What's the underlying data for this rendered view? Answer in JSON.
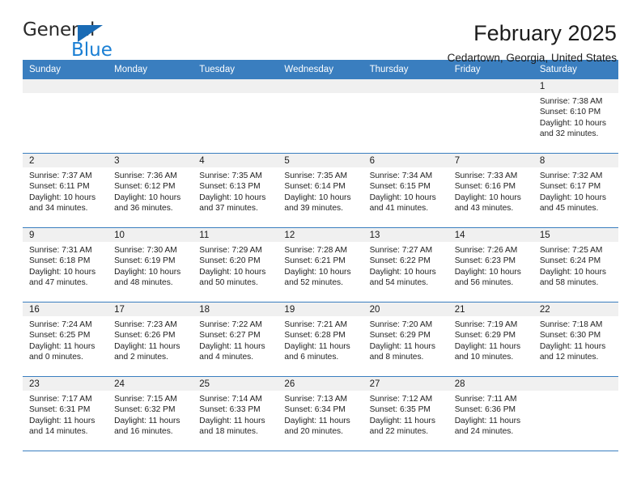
{
  "brand": {
    "word_one": "General",
    "word_two": "Blue",
    "triangle_color": "#1a6bb5",
    "blue_color": "#1a7fd4"
  },
  "header": {
    "title": "February 2025",
    "subtitle": "Cedartown, Georgia, United States"
  },
  "theme": {
    "header_blue": "#3a7ebf",
    "daynum_gray": "#f0f0f0"
  },
  "weekdays": [
    "Sunday",
    "Monday",
    "Tuesday",
    "Wednesday",
    "Thursday",
    "Friday",
    "Saturday"
  ],
  "weeks": [
    [
      {
        "day": "",
        "sunrise": "",
        "sunset": "",
        "daylight": "",
        "blank": true
      },
      {
        "day": "",
        "sunrise": "",
        "sunset": "",
        "daylight": "",
        "blank": true
      },
      {
        "day": "",
        "sunrise": "",
        "sunset": "",
        "daylight": "",
        "blank": true
      },
      {
        "day": "",
        "sunrise": "",
        "sunset": "",
        "daylight": "",
        "blank": true
      },
      {
        "day": "",
        "sunrise": "",
        "sunset": "",
        "daylight": "",
        "blank": true
      },
      {
        "day": "",
        "sunrise": "",
        "sunset": "",
        "daylight": "",
        "blank": true
      },
      {
        "day": "1",
        "sunrise": "Sunrise: 7:38 AM",
        "sunset": "Sunset: 6:10 PM",
        "daylight": "Daylight: 10 hours and 32 minutes."
      }
    ],
    [
      {
        "day": "2",
        "sunrise": "Sunrise: 7:37 AM",
        "sunset": "Sunset: 6:11 PM",
        "daylight": "Daylight: 10 hours and 34 minutes."
      },
      {
        "day": "3",
        "sunrise": "Sunrise: 7:36 AM",
        "sunset": "Sunset: 6:12 PM",
        "daylight": "Daylight: 10 hours and 36 minutes."
      },
      {
        "day": "4",
        "sunrise": "Sunrise: 7:35 AM",
        "sunset": "Sunset: 6:13 PM",
        "daylight": "Daylight: 10 hours and 37 minutes."
      },
      {
        "day": "5",
        "sunrise": "Sunrise: 7:35 AM",
        "sunset": "Sunset: 6:14 PM",
        "daylight": "Daylight: 10 hours and 39 minutes."
      },
      {
        "day": "6",
        "sunrise": "Sunrise: 7:34 AM",
        "sunset": "Sunset: 6:15 PM",
        "daylight": "Daylight: 10 hours and 41 minutes."
      },
      {
        "day": "7",
        "sunrise": "Sunrise: 7:33 AM",
        "sunset": "Sunset: 6:16 PM",
        "daylight": "Daylight: 10 hours and 43 minutes."
      },
      {
        "day": "8",
        "sunrise": "Sunrise: 7:32 AM",
        "sunset": "Sunset: 6:17 PM",
        "daylight": "Daylight: 10 hours and 45 minutes."
      }
    ],
    [
      {
        "day": "9",
        "sunrise": "Sunrise: 7:31 AM",
        "sunset": "Sunset: 6:18 PM",
        "daylight": "Daylight: 10 hours and 47 minutes."
      },
      {
        "day": "10",
        "sunrise": "Sunrise: 7:30 AM",
        "sunset": "Sunset: 6:19 PM",
        "daylight": "Daylight: 10 hours and 48 minutes."
      },
      {
        "day": "11",
        "sunrise": "Sunrise: 7:29 AM",
        "sunset": "Sunset: 6:20 PM",
        "daylight": "Daylight: 10 hours and 50 minutes."
      },
      {
        "day": "12",
        "sunrise": "Sunrise: 7:28 AM",
        "sunset": "Sunset: 6:21 PM",
        "daylight": "Daylight: 10 hours and 52 minutes."
      },
      {
        "day": "13",
        "sunrise": "Sunrise: 7:27 AM",
        "sunset": "Sunset: 6:22 PM",
        "daylight": "Daylight: 10 hours and 54 minutes."
      },
      {
        "day": "14",
        "sunrise": "Sunrise: 7:26 AM",
        "sunset": "Sunset: 6:23 PM",
        "daylight": "Daylight: 10 hours and 56 minutes."
      },
      {
        "day": "15",
        "sunrise": "Sunrise: 7:25 AM",
        "sunset": "Sunset: 6:24 PM",
        "daylight": "Daylight: 10 hours and 58 minutes."
      }
    ],
    [
      {
        "day": "16",
        "sunrise": "Sunrise: 7:24 AM",
        "sunset": "Sunset: 6:25 PM",
        "daylight": "Daylight: 11 hours and 0 minutes."
      },
      {
        "day": "17",
        "sunrise": "Sunrise: 7:23 AM",
        "sunset": "Sunset: 6:26 PM",
        "daylight": "Daylight: 11 hours and 2 minutes."
      },
      {
        "day": "18",
        "sunrise": "Sunrise: 7:22 AM",
        "sunset": "Sunset: 6:27 PM",
        "daylight": "Daylight: 11 hours and 4 minutes."
      },
      {
        "day": "19",
        "sunrise": "Sunrise: 7:21 AM",
        "sunset": "Sunset: 6:28 PM",
        "daylight": "Daylight: 11 hours and 6 minutes."
      },
      {
        "day": "20",
        "sunrise": "Sunrise: 7:20 AM",
        "sunset": "Sunset: 6:29 PM",
        "daylight": "Daylight: 11 hours and 8 minutes."
      },
      {
        "day": "21",
        "sunrise": "Sunrise: 7:19 AM",
        "sunset": "Sunset: 6:29 PM",
        "daylight": "Daylight: 11 hours and 10 minutes."
      },
      {
        "day": "22",
        "sunrise": "Sunrise: 7:18 AM",
        "sunset": "Sunset: 6:30 PM",
        "daylight": "Daylight: 11 hours and 12 minutes."
      }
    ],
    [
      {
        "day": "23",
        "sunrise": "Sunrise: 7:17 AM",
        "sunset": "Sunset: 6:31 PM",
        "daylight": "Daylight: 11 hours and 14 minutes."
      },
      {
        "day": "24",
        "sunrise": "Sunrise: 7:15 AM",
        "sunset": "Sunset: 6:32 PM",
        "daylight": "Daylight: 11 hours and 16 minutes."
      },
      {
        "day": "25",
        "sunrise": "Sunrise: 7:14 AM",
        "sunset": "Sunset: 6:33 PM",
        "daylight": "Daylight: 11 hours and 18 minutes."
      },
      {
        "day": "26",
        "sunrise": "Sunrise: 7:13 AM",
        "sunset": "Sunset: 6:34 PM",
        "daylight": "Daylight: 11 hours and 20 minutes."
      },
      {
        "day": "27",
        "sunrise": "Sunrise: 7:12 AM",
        "sunset": "Sunset: 6:35 PM",
        "daylight": "Daylight: 11 hours and 22 minutes."
      },
      {
        "day": "28",
        "sunrise": "Sunrise: 7:11 AM",
        "sunset": "Sunset: 6:36 PM",
        "daylight": "Daylight: 11 hours and 24 minutes."
      },
      {
        "day": "",
        "sunrise": "",
        "sunset": "",
        "daylight": "",
        "blank": true
      }
    ]
  ]
}
